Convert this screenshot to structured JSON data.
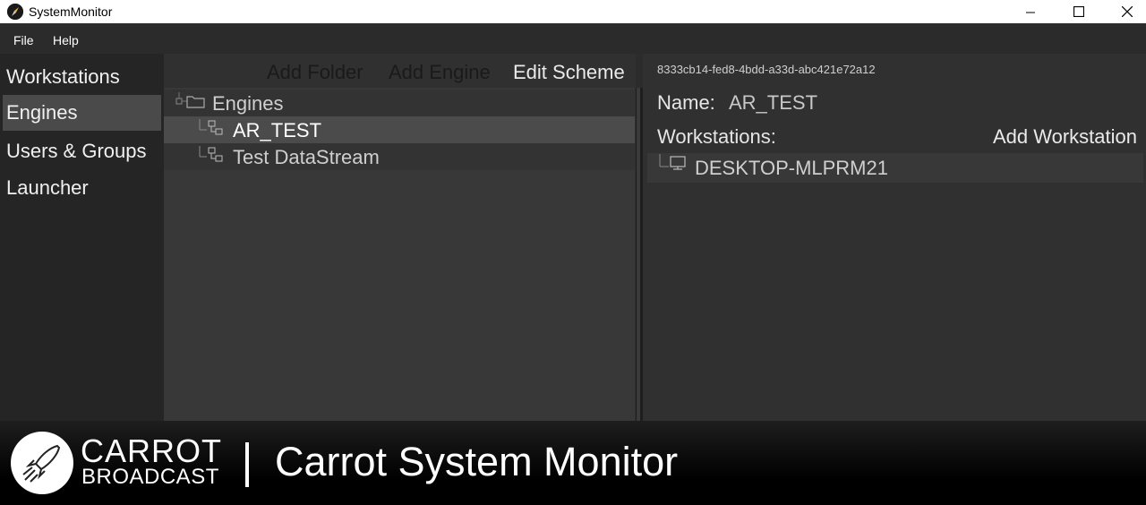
{
  "window": {
    "title": "SystemMonitor",
    "icons": {
      "app": "compass-icon",
      "minimize": "minimize-icon",
      "maximize": "maximize-icon",
      "close": "close-icon"
    }
  },
  "menu": {
    "items": [
      "File",
      "Help"
    ]
  },
  "sidebar": {
    "items": [
      {
        "label": "Workstations",
        "selected": false
      },
      {
        "label": "Engines",
        "selected": true
      },
      {
        "label": "Users & Groups",
        "selected": false
      },
      {
        "label": "Launcher",
        "selected": false
      }
    ]
  },
  "toolbar": {
    "add_folder": "Add Folder",
    "add_engine": "Add Engine",
    "edit_scheme": "Edit Scheme"
  },
  "tree": {
    "root": {
      "label": "Engines",
      "icon": "folder-icon"
    },
    "items": [
      {
        "label": "AR_TEST",
        "icon": "engine-node-icon",
        "selected": true
      },
      {
        "label": "Test DataStream",
        "icon": "engine-node-icon",
        "selected": false
      }
    ]
  },
  "details": {
    "guid": "8333cb14-fed8-4bdd-a33d-abc421e72a12",
    "name_label": "Name:",
    "name_value": "AR_TEST",
    "workstations_label": "Workstations:",
    "add_workstation": "Add Workstation",
    "workstations": [
      {
        "label": "DESKTOP-MLPRM21",
        "icon": "monitor-icon"
      }
    ]
  },
  "banner": {
    "brand_top": "CARROT",
    "brand_bottom": "BROADCAST",
    "title": "Carrot System Monitor",
    "logo_icon": "rocket-logo-icon"
  },
  "colors": {
    "background": "#2c2c2c",
    "sidebar": "#252525",
    "selected": "#4a4a4a",
    "panel": "#303030",
    "text": "#dddddd"
  }
}
